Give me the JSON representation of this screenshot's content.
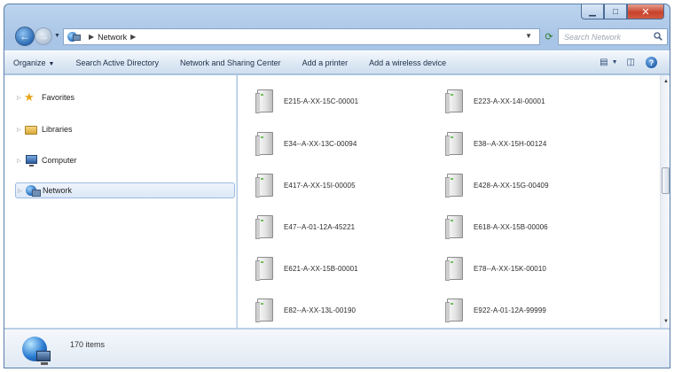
{
  "window": {
    "caption": {
      "minimize": "▁",
      "maximize": "□",
      "close": "✕"
    }
  },
  "address": {
    "crumbs": [
      "Network"
    ],
    "search_placeholder": "Search Network"
  },
  "toolbar": {
    "commands": [
      {
        "label": "Organize",
        "dropdown": true
      },
      {
        "label": "Search Active Directory"
      },
      {
        "label": "Network and Sharing Center"
      },
      {
        "label": "Add a printer"
      },
      {
        "label": "Add a wireless device"
      }
    ]
  },
  "nav": {
    "items": [
      {
        "label": "Favorites",
        "icon": "star-icon"
      },
      {
        "label": "Libraries",
        "icon": "libraries-icon"
      },
      {
        "label": "Computer",
        "icon": "computer-icon"
      },
      {
        "label": "Network",
        "icon": "network-icon",
        "selected": true
      }
    ]
  },
  "content": {
    "items": [
      "E215-A-XX-15C-00001",
      "E223-A-XX-14I-00001",
      "E34--A-XX-13C-00094",
      "E38--A-XX-15H-00124",
      "E417-A-XX-15I-00005",
      "E428-A-XX-15G-00409",
      "E47--A-01-12A-45221",
      "E618-A-XX-15B-00006",
      "E621-A-XX-15B-00001",
      "E78--A-XX-15K-00010",
      "E82--A-XX-13L-00190",
      "E922-A-01-12A-99999"
    ]
  },
  "details": {
    "count": "170 items"
  },
  "colors": {
    "accent": "#1e64b8",
    "close": "#c7432d"
  }
}
